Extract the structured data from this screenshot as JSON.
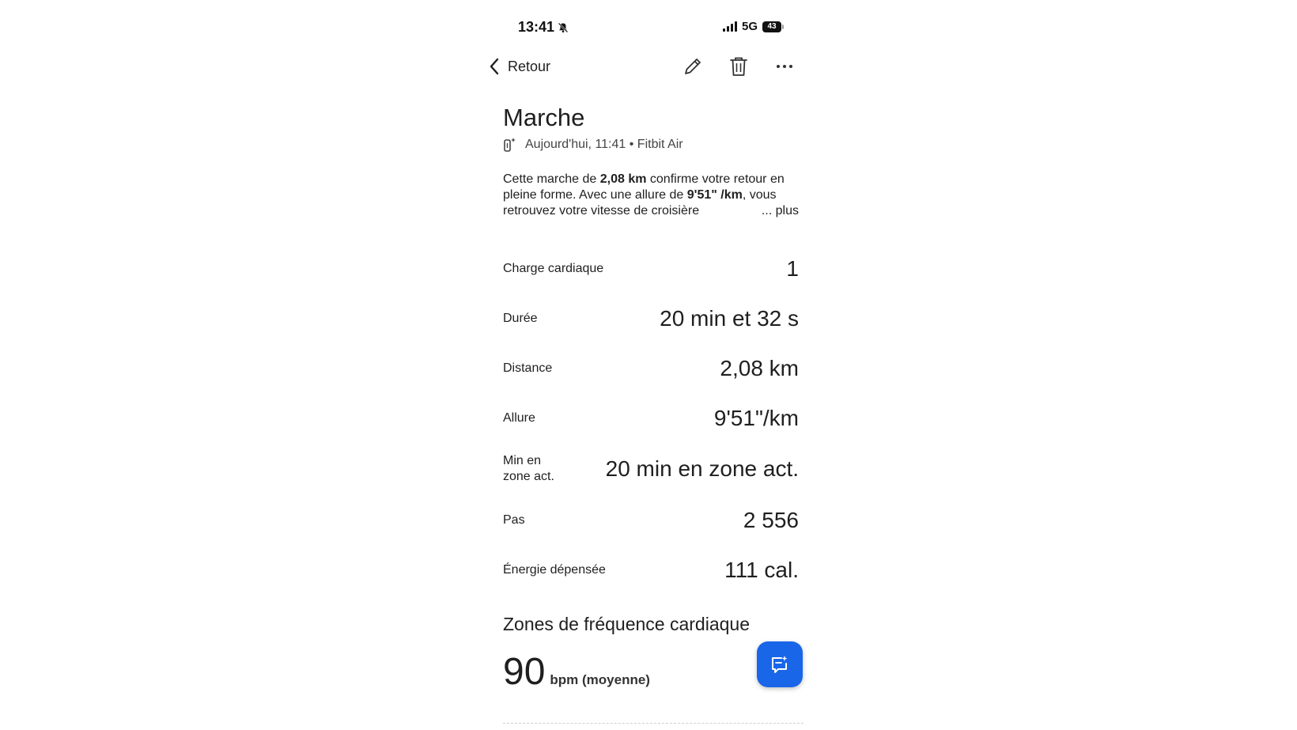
{
  "status_bar": {
    "time": "13:41",
    "network": "5G",
    "battery": "43",
    "icons": [
      "bell-slash-icon",
      "signal-icon",
      "battery-icon"
    ]
  },
  "toolbar": {
    "back_label": "Retour",
    "icons": [
      "chevron-left-icon",
      "pencil-icon",
      "trash-icon",
      "more-horizontal-icon"
    ]
  },
  "activity": {
    "title": "Marche",
    "meta": "Aujourd'hui, 11:41 • Fitbit Air",
    "meta_icon": "tracker-device-icon",
    "summary": {
      "part1": "Cette marche de ",
      "distance": "2,08 km",
      "part2": " confirme votre retour en pleine forme. Avec une allure de ",
      "pace": "9'51\" /km",
      "part3": ", vous retrouvez votre vitesse de croisière",
      "more": "... plus"
    }
  },
  "stats": [
    {
      "label": "Charge cardiaque",
      "value": "1"
    },
    {
      "label": "Durée",
      "value": "20 min et 32 s"
    },
    {
      "label": "Distance",
      "value": "2,08 km"
    },
    {
      "label": "Allure",
      "value": "9'51\"/km"
    },
    {
      "label": "Min en zone act.",
      "value": "20 min en zone act."
    },
    {
      "label": "Pas",
      "value": "2 556"
    },
    {
      "label": "Énergie dépensée",
      "value": "111 cal."
    }
  ],
  "heart_zones": {
    "title": "Zones de fréquence cardiaque",
    "average_value": "90",
    "average_unit": "bpm (moyenne)"
  },
  "fab": {
    "icon": "ai-chat-sparkle-icon"
  },
  "colors": {
    "accent": "#1a66e8",
    "text": "#1f1f1f"
  }
}
